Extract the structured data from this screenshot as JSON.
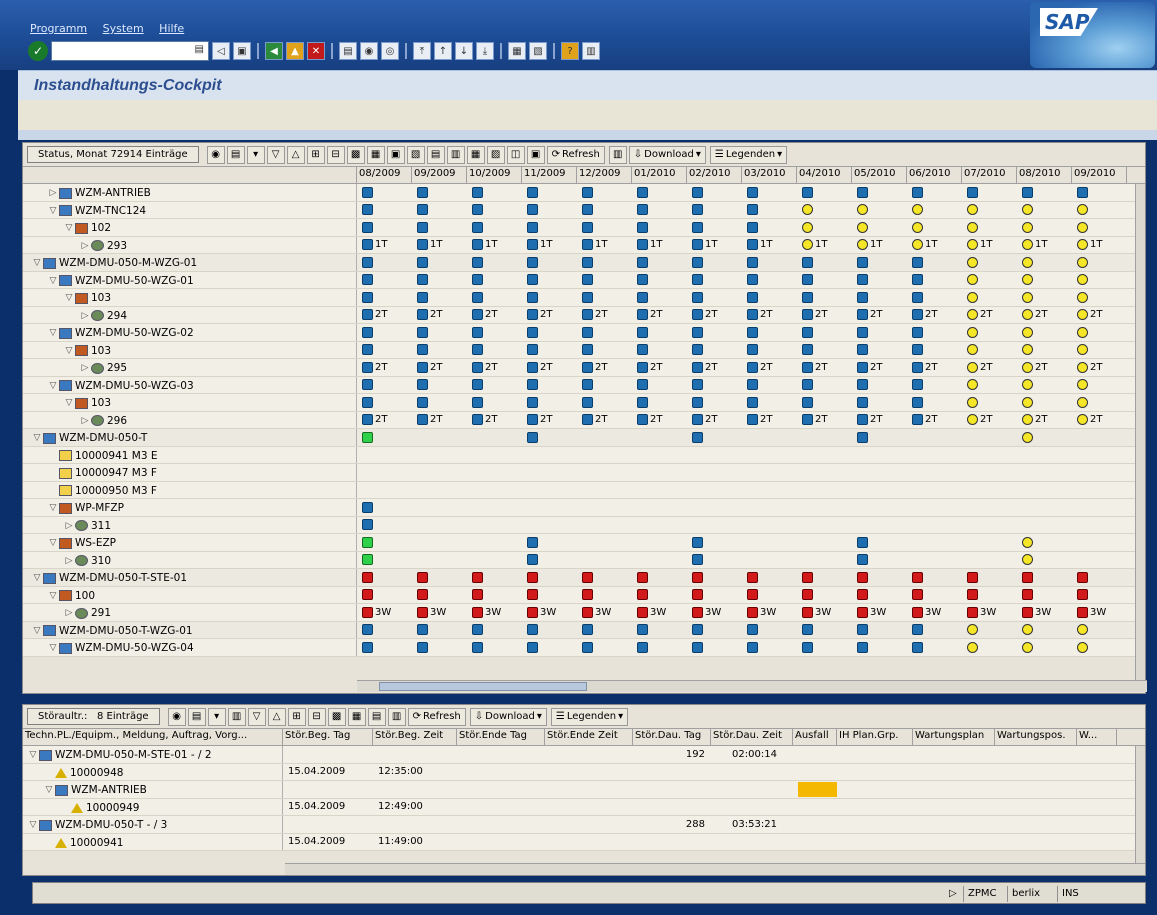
{
  "menu": [
    "Programm",
    "System",
    "Hilfe"
  ],
  "app_title": "Instandhaltungs-Cockpit",
  "sap_logo": "SAP",
  "upper": {
    "title": "Status, Monat 72914 Einträge",
    "buttons": [
      "Refresh",
      "Download",
      "Legenden"
    ],
    "months": [
      "08/2009",
      "09/2009",
      "10/2009",
      "11/2009",
      "12/2009",
      "01/2010",
      "02/2010",
      "03/2010",
      "04/2010",
      "05/2010",
      "06/2010",
      "07/2010",
      "08/2010",
      "09/2010"
    ],
    "rows": [
      {
        "indent": 1,
        "arrow": "▷",
        "icon": "mach",
        "label": "WZM-ANTRIEB",
        "cells": "BBBBBBBBBBBBBB",
        "txt": ""
      },
      {
        "indent": 1,
        "arrow": "▽",
        "icon": "mach",
        "label": "WZM-TNC124",
        "cells": "BBBBBBBBYYYYYY",
        "txt": ""
      },
      {
        "indent": 2,
        "arrow": "▽",
        "icon": "grp",
        "label": "102",
        "cells": "BBBBBBBBYYYYYY",
        "txt": ""
      },
      {
        "indent": 3,
        "arrow": "▷",
        "icon": "gear",
        "label": "293",
        "cells": "BBBBBBBBYYYYYY",
        "txt": "1T"
      },
      {
        "indent": 0,
        "arrow": "▽",
        "icon": "mach",
        "label": "WZM-DMU-050-M-WZG-01",
        "cells": "BBBBBBBBBBBYYY",
        "txt": ""
      },
      {
        "indent": 1,
        "arrow": "▽",
        "icon": "mach",
        "label": "WZM-DMU-50-WZG-01",
        "cells": "BBBBBBBBBBBYYY",
        "txt": ""
      },
      {
        "indent": 2,
        "arrow": "▽",
        "icon": "grp",
        "label": "103",
        "cells": "BBBBBBBBBBBYYY",
        "txt": ""
      },
      {
        "indent": 3,
        "arrow": "▷",
        "icon": "gear",
        "label": "294",
        "cells": "BBBBBBBBBBBYYY",
        "txt": "2T"
      },
      {
        "indent": 1,
        "arrow": "▽",
        "icon": "mach",
        "label": "WZM-DMU-50-WZG-02",
        "cells": "BBBBBBBBBBBYYY",
        "txt": ""
      },
      {
        "indent": 2,
        "arrow": "▽",
        "icon": "grp",
        "label": "103",
        "cells": "BBBBBBBBBBBYYY",
        "txt": ""
      },
      {
        "indent": 3,
        "arrow": "▷",
        "icon": "gear",
        "label": "295",
        "cells": "BBBBBBBBBBBYYY",
        "txt": "2T"
      },
      {
        "indent": 1,
        "arrow": "▽",
        "icon": "mach",
        "label": "WZM-DMU-50-WZG-03",
        "cells": "BBBBBBBBBBBYYY",
        "txt": ""
      },
      {
        "indent": 2,
        "arrow": "▽",
        "icon": "grp",
        "label": "103",
        "cells": "BBBBBBBBBBBYYY",
        "txt": ""
      },
      {
        "indent": 3,
        "arrow": "▷",
        "icon": "gear",
        "label": "296",
        "cells": "BBBBBBBBBBBYYY",
        "txt": "2T"
      },
      {
        "indent": 0,
        "arrow": "▽",
        "icon": "mach",
        "label": "WZM-DMU-050-T",
        "cells": "G..B..B..B..Y.",
        "txt": ""
      },
      {
        "indent": 1,
        "arrow": "",
        "icon": "doc",
        "label": "10000941 M3 E",
        "cells": "..............",
        "txt": ""
      },
      {
        "indent": 1,
        "arrow": "",
        "icon": "doc",
        "label": "10000947 M3 F",
        "cells": "..............",
        "txt": ""
      },
      {
        "indent": 1,
        "arrow": "",
        "icon": "doc",
        "label": "10000950 M3 F",
        "cells": "..............",
        "txt": ""
      },
      {
        "indent": 1,
        "arrow": "▽",
        "icon": "grp",
        "label": "WP-MFZP",
        "cells": "B.............",
        "txt": ""
      },
      {
        "indent": 2,
        "arrow": "▷",
        "icon": "gear",
        "label": "311",
        "cells": "B.............",
        "txt": ""
      },
      {
        "indent": 1,
        "arrow": "▽",
        "icon": "grp",
        "label": "WS-EZP",
        "cells": "G..B..B..B..Y.",
        "txt": ""
      },
      {
        "indent": 2,
        "arrow": "▷",
        "icon": "gear",
        "label": "310",
        "cells": "G..B..B..B..Y.",
        "txt": ""
      },
      {
        "indent": 0,
        "arrow": "▽",
        "icon": "mach",
        "label": "WZM-DMU-050-T-STE-01",
        "cells": "RRRRRRRRRRRRRR",
        "txt": ""
      },
      {
        "indent": 1,
        "arrow": "▽",
        "icon": "grp",
        "label": "100",
        "cells": "RRRRRRRRRRRRRR",
        "txt": ""
      },
      {
        "indent": 2,
        "arrow": "▷",
        "icon": "gear",
        "label": "291",
        "cells": "RRRRRRRRRRRRRR",
        "txt": "3W"
      },
      {
        "indent": 0,
        "arrow": "▽",
        "icon": "mach",
        "label": "WZM-DMU-050-T-WZG-01",
        "cells": "BBBBBBBBBBBYYY",
        "txt": ""
      },
      {
        "indent": 1,
        "arrow": "▽",
        "icon": "mach",
        "label": "WZM-DMU-50-WZG-04",
        "cells": "BBBBBBBBBBBYYY",
        "txt": ""
      }
    ]
  },
  "lower": {
    "title": "Störaultr.:",
    "count": "8 Einträge",
    "buttons": [
      "Refresh",
      "Download",
      "Legenden"
    ],
    "columns": [
      "Techn.PL./Equipm., Meldung, Auftrag, Vorg...",
      "Stör.Beg. Tag",
      "Stör.Beg. Zeit",
      "Stör.Ende Tag",
      "Stör.Ende Zeit",
      "Stör.Dau. Tag",
      "Stör.Dau. Zeit",
      "Ausfall",
      "IH Plan.Grp.",
      "Wartungsplan",
      "Wartungspos.",
      "W..."
    ],
    "rows": [
      {
        "indent": 0,
        "arrow": "▽",
        "icon": "mach",
        "label": "WZM-DMU-050-M-STE-01 - / 2",
        "beg_tag": "",
        "beg_zeit": "",
        "dau_tag": "192",
        "dau_zeit": "02:00:14",
        "ausfall": false
      },
      {
        "indent": 1,
        "arrow": "",
        "icon": "tri",
        "label": "10000948",
        "beg_tag": "15.04.2009",
        "beg_zeit": "12:35:00",
        "dau_tag": "",
        "dau_zeit": "",
        "ausfall": false
      },
      {
        "indent": 1,
        "arrow": "▽",
        "icon": "mach",
        "label": "WZM-ANTRIEB",
        "beg_tag": "",
        "beg_zeit": "",
        "dau_tag": "",
        "dau_zeit": "",
        "ausfall": true
      },
      {
        "indent": 2,
        "arrow": "",
        "icon": "tri",
        "label": "10000949",
        "beg_tag": "15.04.2009",
        "beg_zeit": "12:49:00",
        "dau_tag": "",
        "dau_zeit": "",
        "ausfall": false
      },
      {
        "indent": 0,
        "arrow": "▽",
        "icon": "mach",
        "label": "WZM-DMU-050-T - / 3",
        "beg_tag": "",
        "beg_zeit": "",
        "dau_tag": "288",
        "dau_zeit": "03:53:21",
        "ausfall": false
      },
      {
        "indent": 1,
        "arrow": "",
        "icon": "tri",
        "label": "10000941",
        "beg_tag": "15.04.2009",
        "beg_zeit": "11:49:00",
        "dau_tag": "",
        "dau_zeit": "",
        "ausfall": false
      }
    ]
  },
  "status": {
    "tx": "ZPMC",
    "server": "berlix",
    "mode": "INS"
  },
  "colors": {
    "blue": "#1f6fb0",
    "yellow": "#f5e627",
    "green": "#2fd04a",
    "red": "#d21a1a",
    "ausfall": "#f5b800"
  }
}
